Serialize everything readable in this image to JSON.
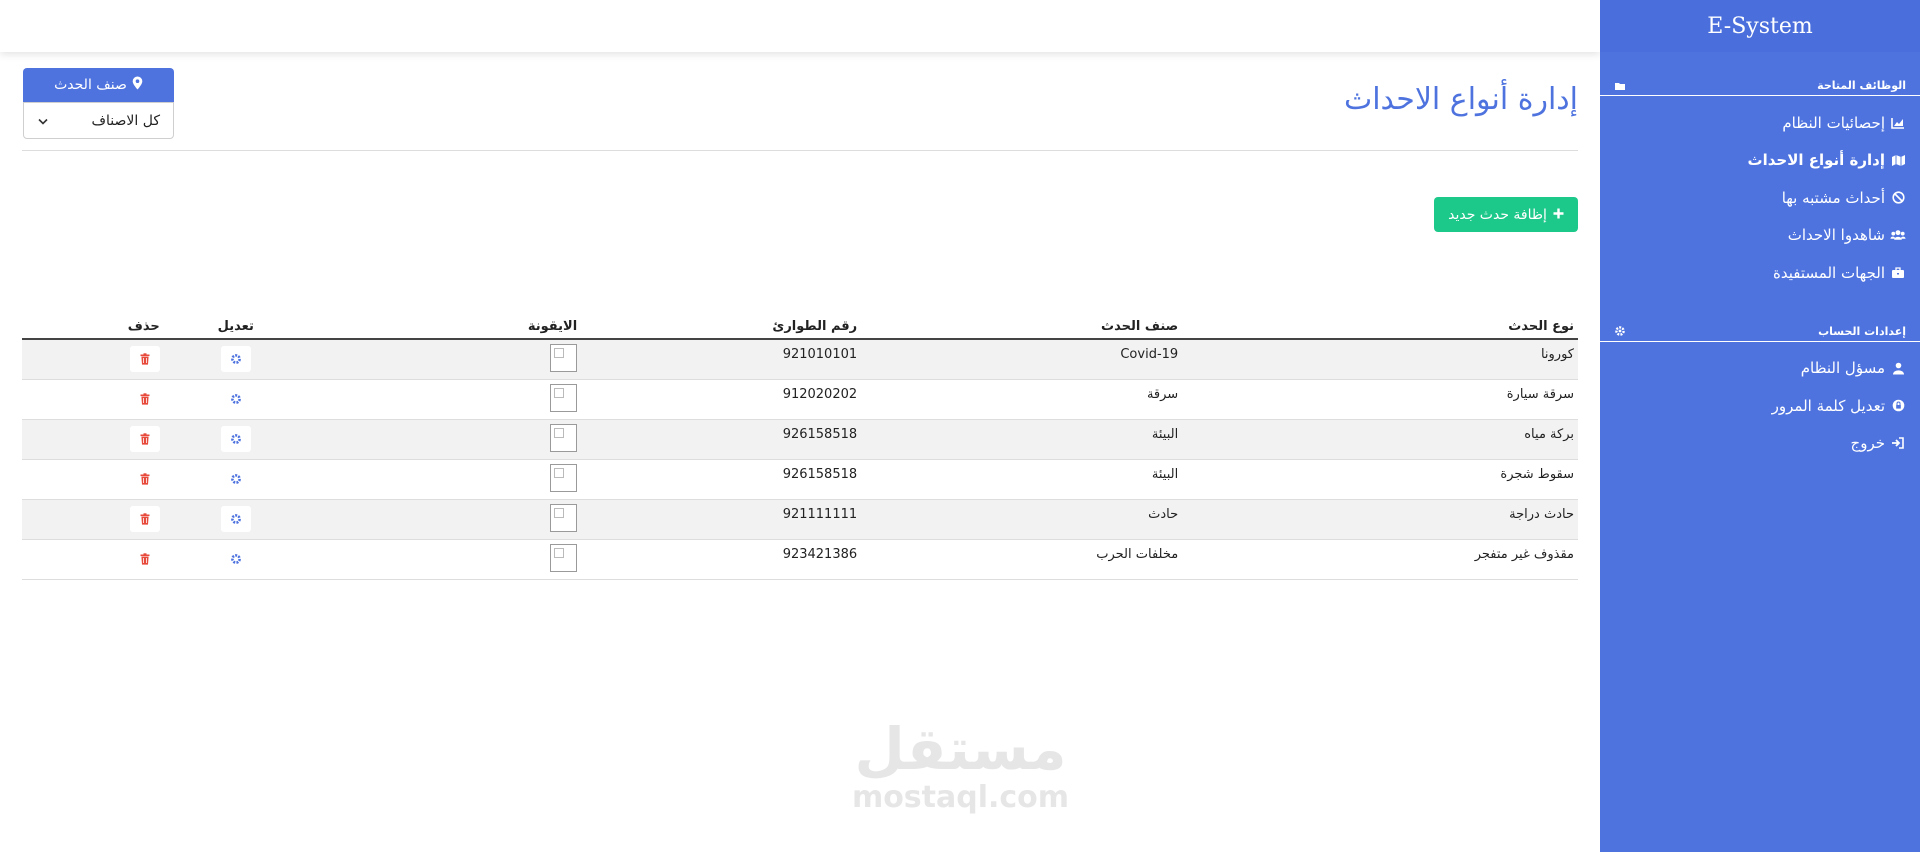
{
  "brand": "E-System",
  "sidebar": {
    "section_functions": "الوظائف المتاحة",
    "items": [
      {
        "label": "إحصائيات النظام",
        "icon": "chart-area-icon"
      },
      {
        "label": "إدارة أنواع الاحداث",
        "icon": "map-icon",
        "active": true
      },
      {
        "label": "أحداث مشتبه بها",
        "icon": "ban-icon"
      },
      {
        "label": "شاهدوا الاحداث",
        "icon": "users-icon"
      },
      {
        "label": "الجهات المستفيدة",
        "icon": "briefcase-icon"
      }
    ],
    "section_account": "إعدادات الحساب",
    "account_items": [
      {
        "label": "مسؤل النظام",
        "icon": "user-icon"
      },
      {
        "label": "تعديل كلمة المرور",
        "icon": "lock-icon"
      },
      {
        "label": "خروج",
        "icon": "sign-out-icon"
      }
    ]
  },
  "page": {
    "title": "إدارة أنواع الاحداث",
    "filter_label": "صنف الحدث",
    "filter_selected": "كل الاصناف",
    "add_button": "إظافة حدث جديد"
  },
  "table": {
    "headers": {
      "type": "نوع الحدث",
      "category": "صنف الحدث",
      "emergency": "رقم الطوارئ",
      "icon": "الايقونة",
      "edit": "تعديل",
      "delete": "حذف"
    },
    "rows": [
      {
        "type": "كورونا",
        "category": "Covid-19",
        "emergency": "921010101"
      },
      {
        "type": "سرقة سيارة",
        "category": "سرقة",
        "emergency": "912020202"
      },
      {
        "type": "بركة مياه",
        "category": "البيئة",
        "emergency": "926158518"
      },
      {
        "type": "سقوط شجرة",
        "category": "البيئة",
        "emergency": "926158518"
      },
      {
        "type": "حادث دراجة",
        "category": "حادث",
        "emergency": "921111111"
      },
      {
        "type": "مقذوف غير متفجر",
        "category": "مخلفات الحرب",
        "emergency": "923421386"
      }
    ]
  },
  "watermark": {
    "arabic": "مستقل",
    "latin": "mostaql.com"
  },
  "colors": {
    "primary": "#4e73df",
    "success": "#1cc88a",
    "danger": "#e74a3b"
  }
}
